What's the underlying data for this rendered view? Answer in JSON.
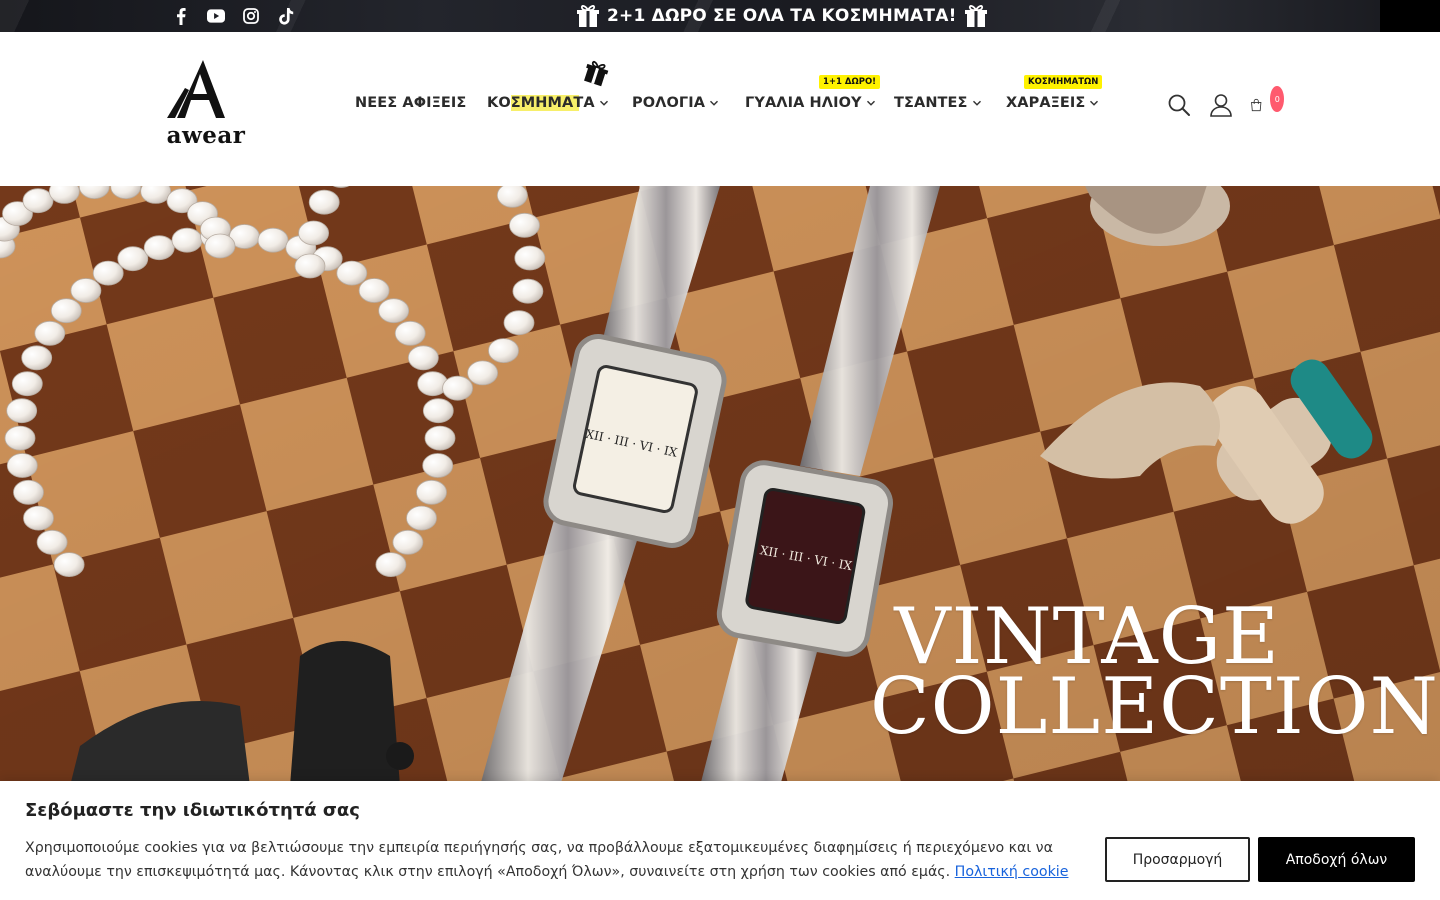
{
  "topbar": {
    "promo_text": "2+1 ΔΩΡΟ ΣΕ ΟΛΑ ΤΑ ΚΟΣΜΗΜΑΤΑ!",
    "socials": [
      "facebook-icon",
      "youtube-icon",
      "instagram-icon",
      "tiktok-icon"
    ]
  },
  "header": {
    "logo_text": "awear",
    "nav": [
      {
        "label": "ΝΕΕΣ ΑΦΙΞΕΙΣ",
        "dropdown": false
      },
      {
        "label": "ΚΟΣΜΗΜΑΤΑ",
        "dropdown": true
      },
      {
        "label": "ΡΟΛΟΓΙΑ",
        "dropdown": true
      },
      {
        "label": "ΓΥΑΛΙΑ ΗΛΙΟΥ",
        "dropdown": true,
        "badge": "1+1 ΔΩΡΟ!"
      },
      {
        "label": "ΤΣΑΝΤΕΣ",
        "dropdown": true
      },
      {
        "label": "ΧΑΡΑΞΕΙΣ",
        "dropdown": true,
        "badge": "ΚΟΣΜΗΜΑΤΩΝ"
      }
    ],
    "cart_count": "0",
    "badge_color": "#fff200",
    "cart_badge_color": "#ff5a6e"
  },
  "hero": {
    "title_line1": "VINTAGE",
    "title_line2": "COLLECTION"
  },
  "cookie": {
    "title": "Σεβόμαστε την ιδιωτικότητά σας",
    "text": "Χρησιμοποιούμε cookies για να βελτιώσουμε την εμπειρία περιήγησής σας, να προβάλλουμε εξατομικευμένες διαφημίσεις ή περιεχόμενο και να αναλύουμε την επισκεψιμότητά μας. Κάνοντας κλικ στην επιλογή «Αποδοχή Όλων», συναινείτε στη χρήση των cookies από εμάς.",
    "link": "Πολιτική cookie",
    "customize_label": "Προσαρμογή",
    "accept_label": "Αποδοχή όλων",
    "link_color": "#1863dc"
  }
}
